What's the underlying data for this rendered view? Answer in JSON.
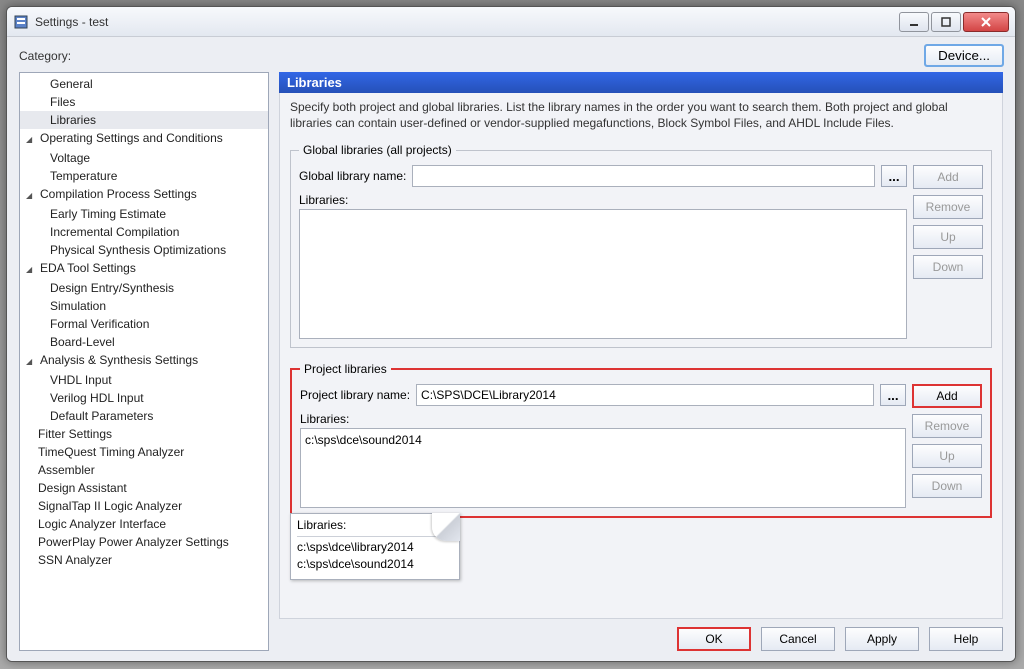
{
  "window": {
    "title": "Settings - test"
  },
  "category_label": "Category:",
  "device_button": "Device...",
  "tree": {
    "items": [
      {
        "label": "General",
        "level": "child"
      },
      {
        "label": "Files",
        "level": "child"
      },
      {
        "label": "Libraries",
        "level": "child",
        "selected": true
      },
      {
        "label": "Operating Settings and Conditions",
        "level": "parent"
      },
      {
        "label": "Voltage",
        "level": "child"
      },
      {
        "label": "Temperature",
        "level": "child"
      },
      {
        "label": "Compilation Process Settings",
        "level": "parent"
      },
      {
        "label": "Early Timing Estimate",
        "level": "child"
      },
      {
        "label": "Incremental Compilation",
        "level": "child"
      },
      {
        "label": "Physical Synthesis Optimizations",
        "level": "child"
      },
      {
        "label": "EDA Tool Settings",
        "level": "parent"
      },
      {
        "label": "Design Entry/Synthesis",
        "level": "child"
      },
      {
        "label": "Simulation",
        "level": "child"
      },
      {
        "label": "Formal Verification",
        "level": "child"
      },
      {
        "label": "Board-Level",
        "level": "child"
      },
      {
        "label": "Analysis & Synthesis Settings",
        "level": "parent"
      },
      {
        "label": "VHDL Input",
        "level": "child"
      },
      {
        "label": "Verilog HDL Input",
        "level": "child"
      },
      {
        "label": "Default Parameters",
        "level": "child"
      },
      {
        "label": "Fitter Settings",
        "level": "child2"
      },
      {
        "label": "TimeQuest Timing Analyzer",
        "level": "child2"
      },
      {
        "label": "Assembler",
        "level": "child2"
      },
      {
        "label": "Design Assistant",
        "level": "child2"
      },
      {
        "label": "SignalTap II Logic Analyzer",
        "level": "child2"
      },
      {
        "label": "Logic Analyzer Interface",
        "level": "child2"
      },
      {
        "label": "PowerPlay Power Analyzer Settings",
        "level": "child2"
      },
      {
        "label": "SSN Analyzer",
        "level": "child2"
      }
    ]
  },
  "panel": {
    "title": "Libraries",
    "description": "Specify both project and global libraries. List the library names in the order you want to search them. Both project and global libraries can contain user-defined or vendor-supplied megafunctions, Block Symbol Files, and AHDL Include Files."
  },
  "global": {
    "legend": "Global libraries (all projects)",
    "name_label": "Global library name:",
    "name_value": "",
    "list_label": "Libraries:",
    "items": []
  },
  "project": {
    "legend": "Project libraries",
    "name_label": "Project library name:",
    "name_value": "C:\\SPS\\DCE\\Library2014",
    "list_label": "Libraries:",
    "items": [
      "c:\\sps\\dce\\sound2014"
    ]
  },
  "buttons": {
    "add": "Add",
    "remove": "Remove",
    "up": "Up",
    "down": "Down",
    "browse": "..."
  },
  "peel": {
    "title": "Libraries:",
    "items": [
      "c:\\sps\\dce\\library2014",
      "c:\\sps\\dce\\sound2014"
    ]
  },
  "dialog": {
    "ok": "OK",
    "cancel": "Cancel",
    "apply": "Apply",
    "help": "Help"
  }
}
